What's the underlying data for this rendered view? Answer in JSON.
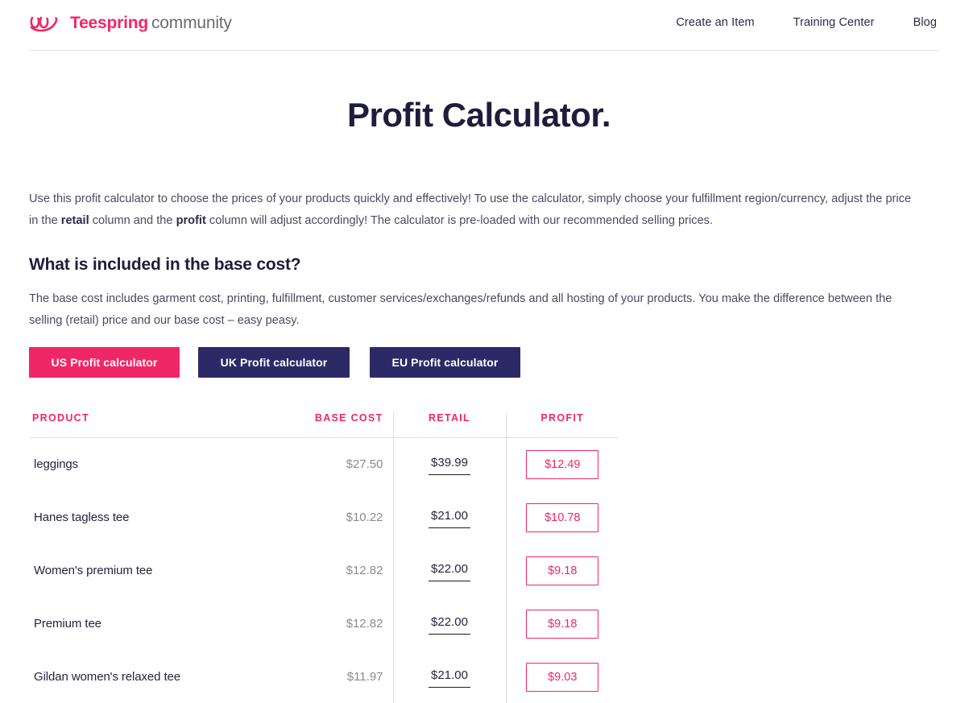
{
  "header": {
    "logo_icon": "teespring-loop-logo-icon",
    "brand_name": "Teespring",
    "brand_sub": "community",
    "nav": [
      {
        "label": "Create an Item"
      },
      {
        "label": "Training Center"
      },
      {
        "label": "Blog"
      }
    ]
  },
  "page": {
    "title": "Profit Calculator."
  },
  "intro": {
    "part1": "Use this profit calculator to choose the prices of your products quickly and effectively! To use the calculator, simply choose your fulfillment region/currency, adjust the price in the ",
    "bold1": "retail",
    "part2": " column and the ",
    "bold2": "profit",
    "part3": " column will adjust accordingly! The calculator is pre-loaded with our recommended selling prices."
  },
  "base_cost_section": {
    "heading": "What is included in the base cost?",
    "body": "The base cost includes garment cost, printing, fulfillment, customer services/exchanges/refunds and all hosting of your products. You make the difference between the selling (retail) price and our base cost – easy peasy."
  },
  "calculator_buttons": [
    {
      "label": "US Profit calculator",
      "active": true,
      "color": "#ef2767"
    },
    {
      "label": "UK Profit calculator",
      "active": false,
      "color": "#2c2a66"
    },
    {
      "label": "EU Profit calculator",
      "active": false,
      "color": "#2c2a66"
    }
  ],
  "table": {
    "columns": [
      "PRODUCT",
      "BASE COST",
      "RETAIL",
      "PROFIT"
    ],
    "rows": [
      {
        "product": "leggings",
        "base_cost": "$27.50",
        "retail": "$39.99",
        "profit": "$12.49"
      },
      {
        "product": "Hanes tagless tee",
        "base_cost": "$10.22",
        "retail": "$21.00",
        "profit": "$10.78"
      },
      {
        "product": "Women's premium tee",
        "base_cost": "$12.82",
        "retail": "$22.00",
        "profit": "$9.18"
      },
      {
        "product": "Premium tee",
        "base_cost": "$12.82",
        "retail": "$22.00",
        "profit": "$9.18"
      },
      {
        "product": "Gildan women's relaxed tee",
        "base_cost": "$11.97",
        "retail": "$21.00",
        "profit": "$9.03"
      }
    ]
  },
  "colors": {
    "accent_pink": "#ef2767",
    "navy": "#2c2a66",
    "title_dark": "#1f1d3c",
    "body_text": "#4a4a63",
    "muted_gray": "#8a8a92"
  }
}
